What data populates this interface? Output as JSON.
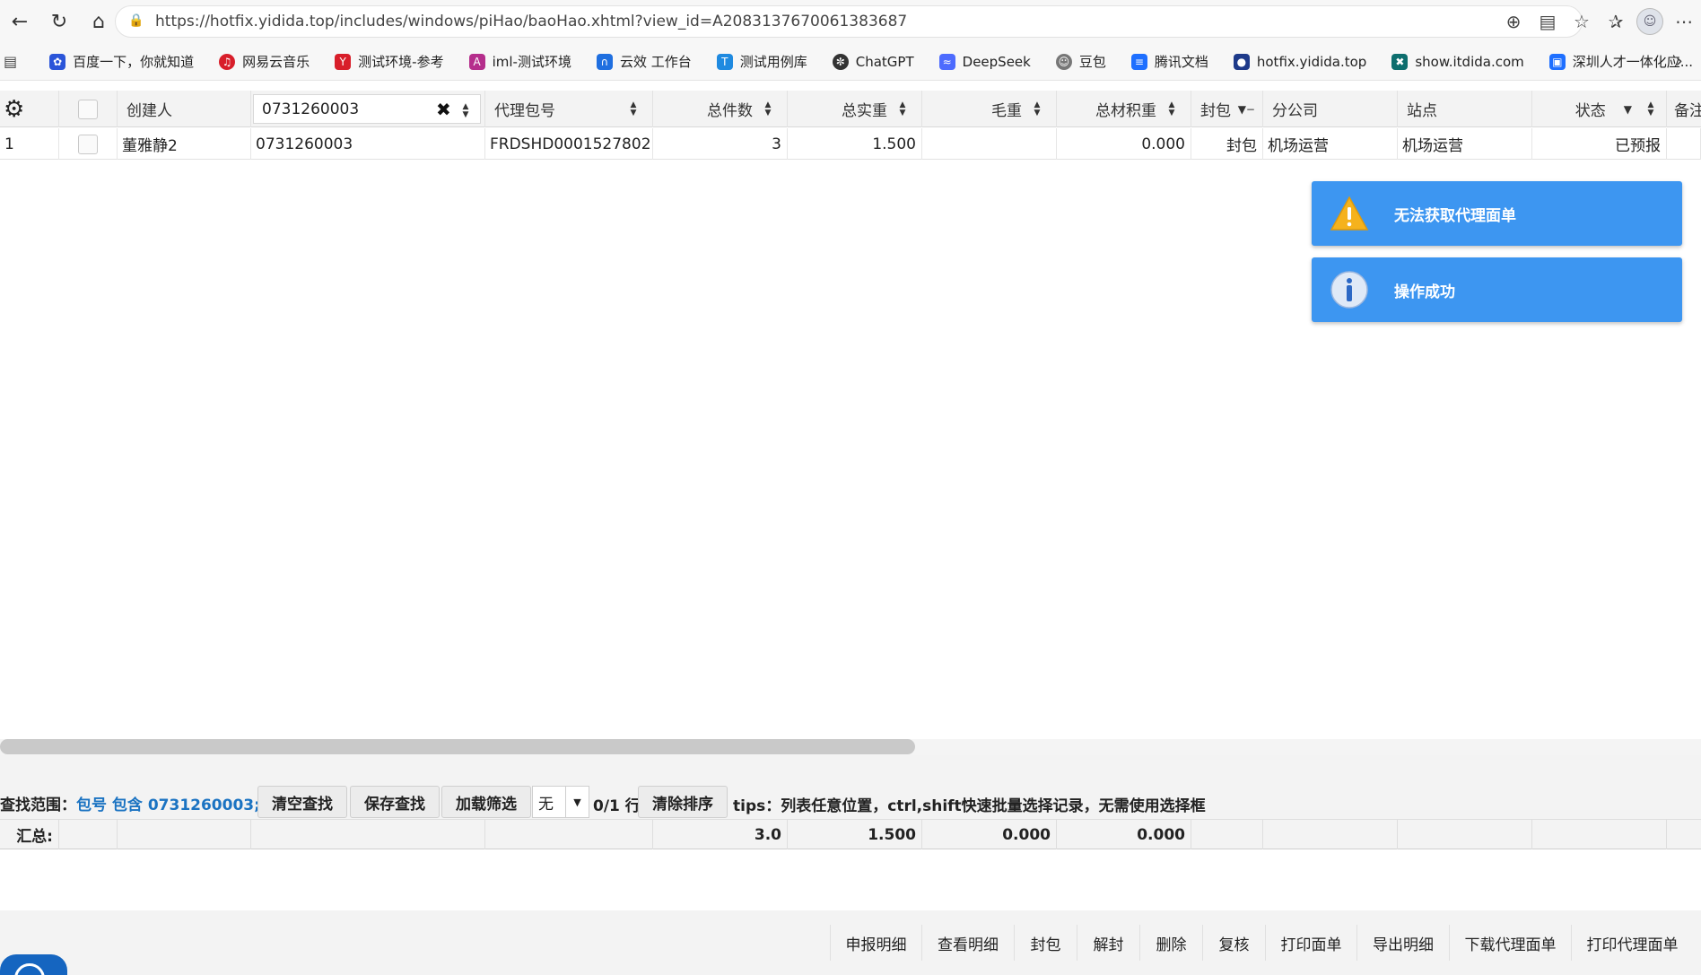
{
  "browser": {
    "url": "https://hotfix.yidida.top/includes/windows/piHao/baoHao.xhtml?view_id=A2083137670061383687",
    "bookmarks": [
      {
        "label": "百度一下，你就知道",
        "icon": "paw-icon",
        "color": "#2b55d9"
      },
      {
        "label": "网易云音乐",
        "icon": "netease-music-icon",
        "color": "#d81e2a"
      },
      {
        "label": "测试环境-参考",
        "icon": "yidida-icon",
        "color": "#d81e2a"
      },
      {
        "label": "iml-测试环境",
        "icon": "angular-icon",
        "color": "#b52e8c"
      },
      {
        "label": "云效 工作台",
        "icon": "cloud-icon",
        "color": "#1f6fe0"
      },
      {
        "label": "测试用例库",
        "icon": "testcase-icon",
        "color": "#1f8ae0"
      },
      {
        "label": "ChatGPT",
        "icon": "chatgpt-icon",
        "color": "#333333"
      },
      {
        "label": "DeepSeek",
        "icon": "deepseek-icon",
        "color": "#4d6bfe"
      },
      {
        "label": "豆包",
        "icon": "doubao-icon",
        "color": "#555555"
      },
      {
        "label": "腾讯文档",
        "icon": "tencent-docs-icon",
        "color": "#1e6fff"
      },
      {
        "label": "hotfix.yidida.top",
        "icon": "site-icon",
        "color": "#1e3a8a"
      },
      {
        "label": "show.itdida.com",
        "icon": "show-icon",
        "color": "#0d6e6e"
      },
      {
        "label": "深圳人才一体化应...",
        "icon": "sz-talent-icon",
        "color": "#1e6fff"
      }
    ]
  },
  "grid": {
    "filter_value": "0731260003",
    "columns": {
      "creator": "创建人",
      "agent_pkg": "代理包号",
      "total_pieces": "总件数",
      "total_weight": "总实重",
      "gross_weight": "毛重",
      "total_vol": "总材积重",
      "seal": "封包",
      "branch": "分公司",
      "site": "站点",
      "status": "状态",
      "remark": "备注"
    },
    "rows": [
      {
        "index": "1",
        "creator": "董雅静2",
        "pkg_no": "0731260003",
        "agent_pkg": "FRDSHD0001527802",
        "total_pieces": "3",
        "total_weight": "1.500",
        "gross_weight": "",
        "total_vol": "0.000",
        "seal": "封包",
        "branch": "机场运营",
        "site": "机场运营",
        "status": "已预报"
      }
    ]
  },
  "toasts": [
    {
      "text": "无法获取代理面单",
      "type": "warning"
    },
    {
      "text": "操作成功",
      "type": "info"
    }
  ],
  "find_bar": {
    "label": "查找范围：",
    "scope": "包号 包含 0731260003;",
    "clear_label": "清空查找",
    "save_label": "保存查找",
    "load_label": "加载筛选",
    "select_value": "无",
    "rows_count": "0/1 行",
    "clear_sort_label": "清除排序",
    "tips": "tips：列表任意位置，ctrl,shift快速批量选择记录，无需使用选择框"
  },
  "summary": {
    "label": "汇总:",
    "total_pieces": "3.0",
    "total_weight": "1.500",
    "gross_weight": "0.000",
    "total_vol": "0.000"
  },
  "actions": [
    "申报明细",
    "查看明细",
    "封包",
    "解封",
    "删除",
    "复核",
    "打印面单",
    "导出明细",
    "下载代理面单",
    "打印代理面单"
  ]
}
